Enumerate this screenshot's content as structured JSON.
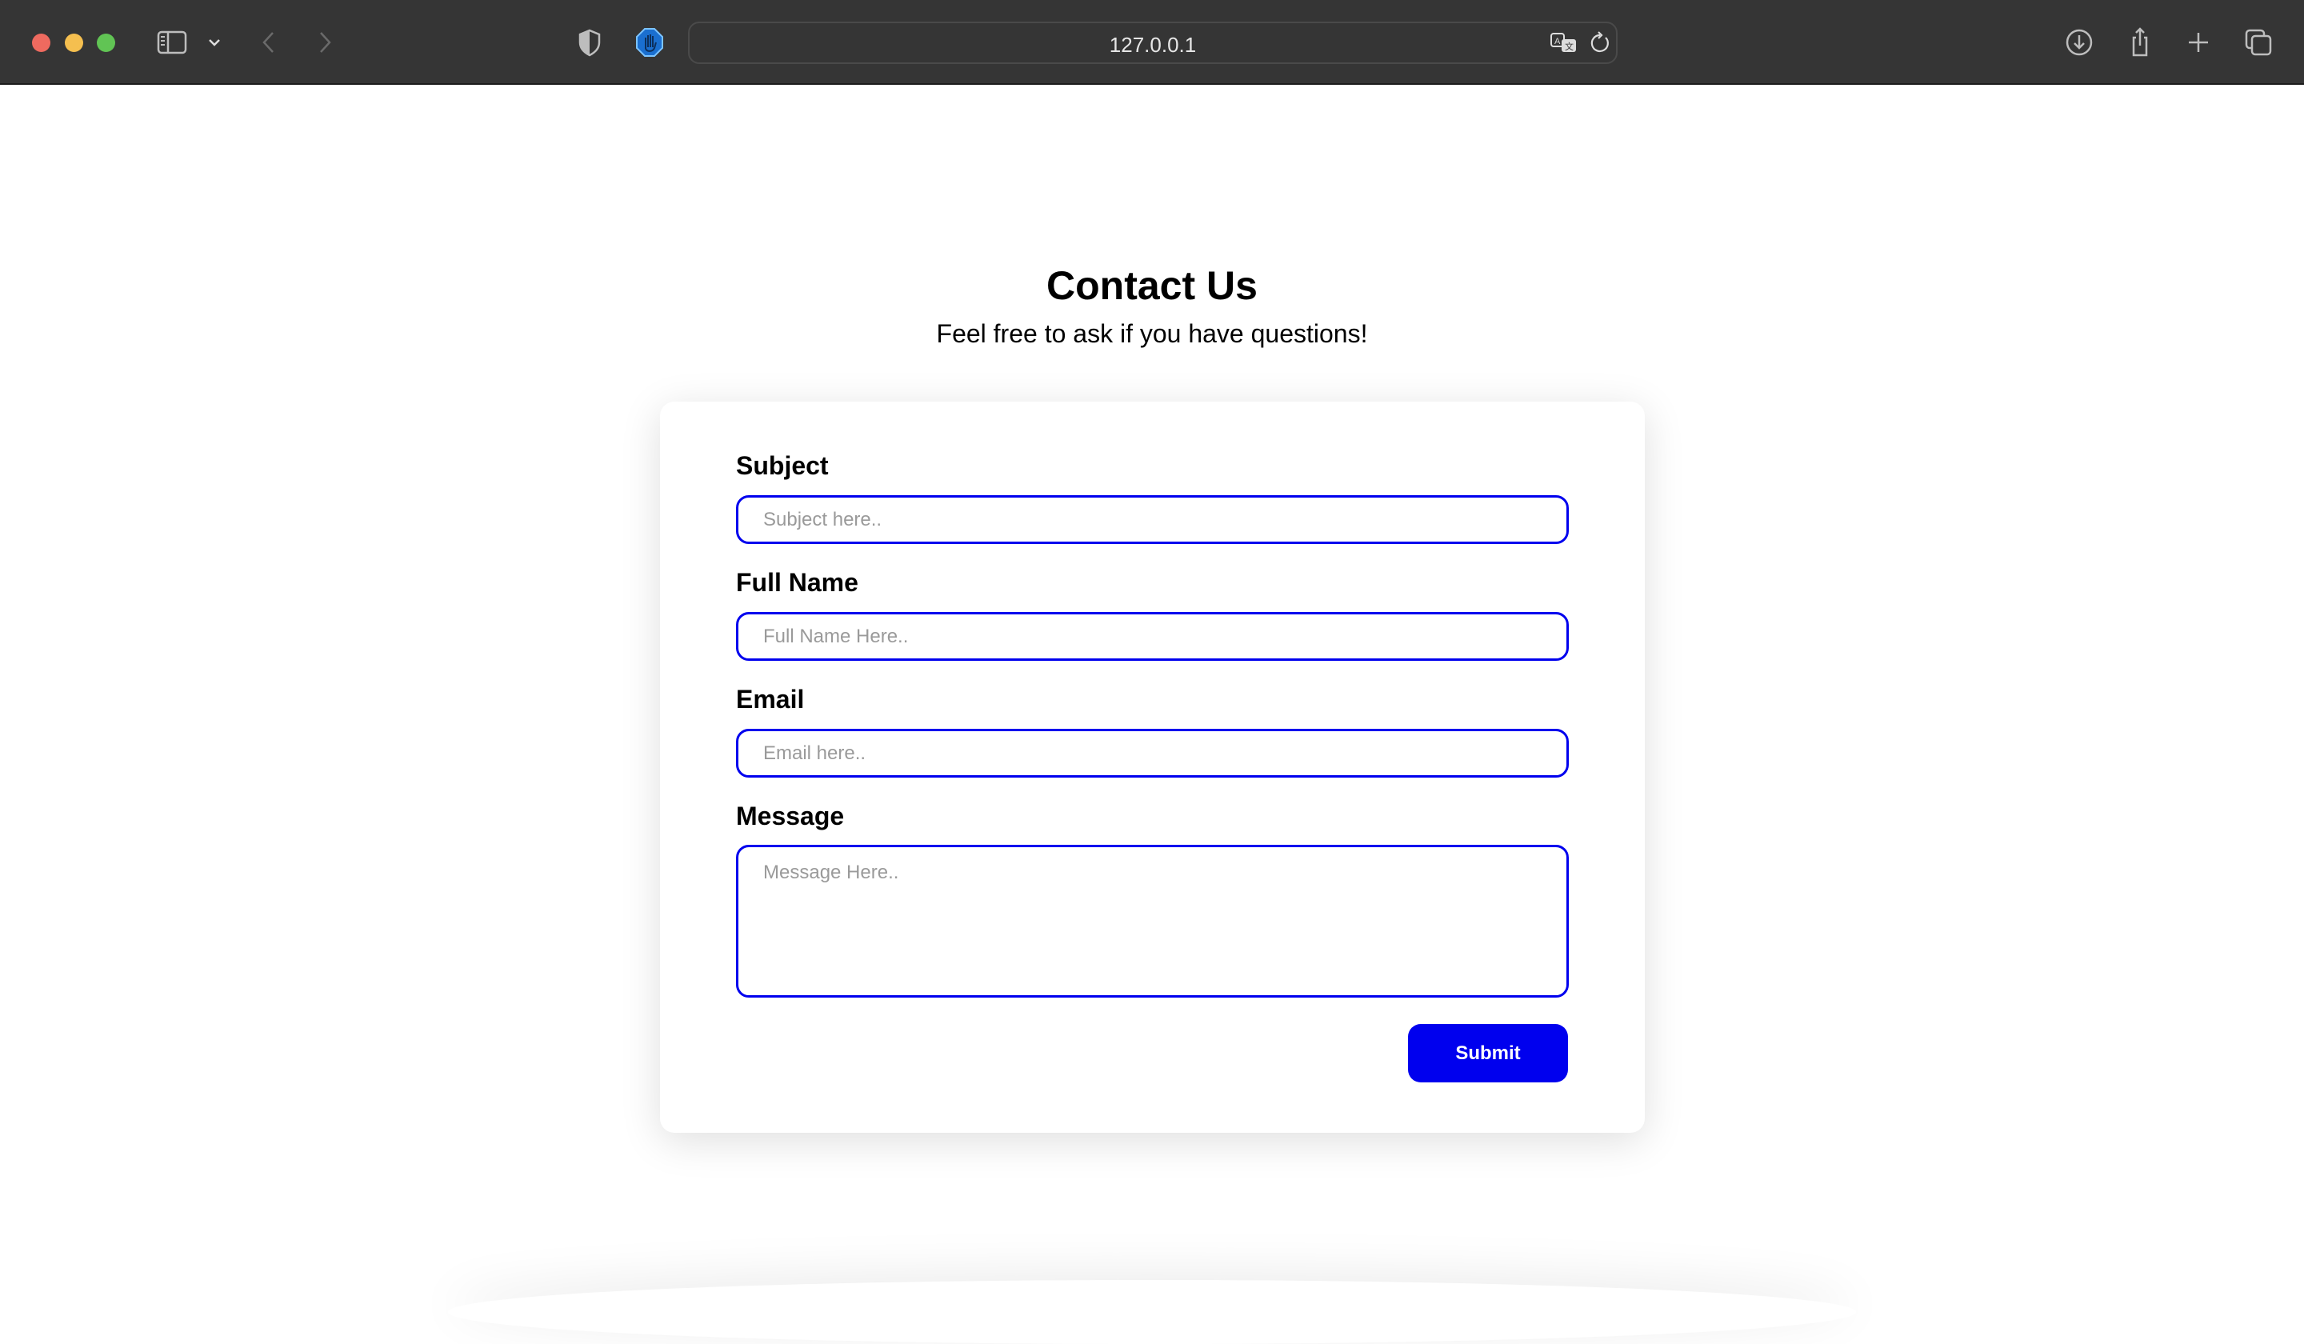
{
  "browser": {
    "url": "127.0.0.1",
    "icons": [
      "sidebar-icon",
      "chevron-down-icon",
      "back-icon",
      "forward-icon",
      "shield-icon",
      "adblock-hand-icon",
      "translate-icon",
      "reload-icon",
      "download-icon",
      "share-icon",
      "new-tab-icon",
      "tabs-overview-icon"
    ],
    "traffic_lights": {
      "close": "#ee6a5f",
      "minimize": "#f5bf4f",
      "maximize": "#61c454"
    }
  },
  "page": {
    "title": "Contact Us",
    "subtitle": "Feel free to ask if you have questions!"
  },
  "form": {
    "subject": {
      "label": "Subject",
      "placeholder": "Subject here..",
      "value": ""
    },
    "full_name": {
      "label": "Full Name",
      "placeholder": "Full Name Here..",
      "value": ""
    },
    "email": {
      "label": "Email",
      "placeholder": "Email here..",
      "value": ""
    },
    "message": {
      "label": "Message",
      "placeholder": "Message Here..",
      "value": ""
    },
    "submit_label": "Submit"
  },
  "colors": {
    "accent": "#0000ee",
    "toolbar": "#353535"
  }
}
